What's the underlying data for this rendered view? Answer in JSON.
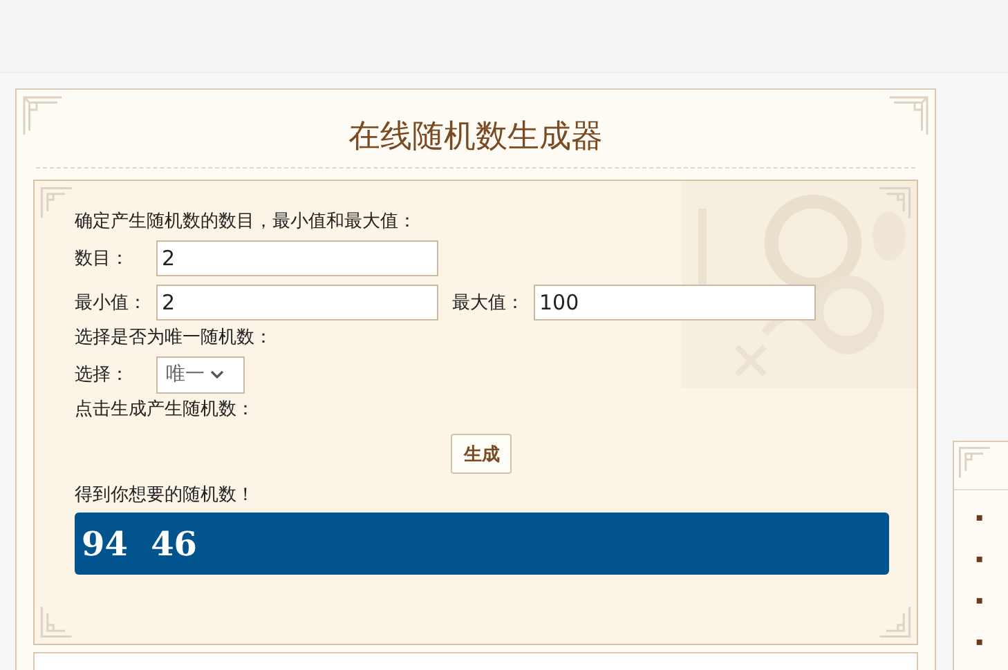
{
  "title": "在线随机数生成器",
  "form": {
    "intro": "确定产生随机数的数目，最小值和最大值：",
    "count": {
      "label": "数目：",
      "value": "2"
    },
    "min": {
      "label": "最小值：",
      "value": "2"
    },
    "max": {
      "label": "最大值：",
      "value": "100"
    },
    "unique_prompt": "选择是否为唯一随机数：",
    "choice": {
      "label": "选择：",
      "value": "唯一"
    },
    "generate_prompt": "点击生成产生随机数：",
    "generate_button": "生成",
    "result_label": "得到你想要的随机数！",
    "result": "94  46"
  },
  "side_panel": {
    "bullets": [
      "▪",
      "▪",
      "▪",
      "▪"
    ]
  }
}
